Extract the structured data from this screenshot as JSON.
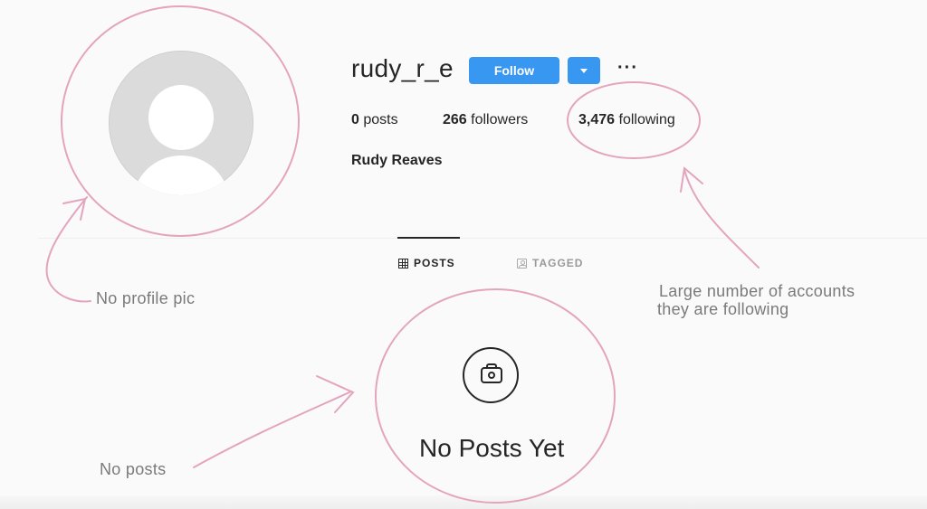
{
  "profile": {
    "username": "rudy_r_e",
    "full_name": "Rudy Reaves",
    "follow_label": "Follow",
    "more_label": "···",
    "stats": {
      "posts": {
        "count": "0",
        "label": "posts"
      },
      "followers": {
        "count": "266",
        "label": "followers"
      },
      "following": {
        "count": "3,476",
        "label": "following"
      }
    }
  },
  "tabs": [
    {
      "label": "POSTS",
      "icon": "grid-icon",
      "active": true
    },
    {
      "label": "TAGGED",
      "icon": "tagged-person-icon",
      "active": false
    }
  ],
  "empty_state": {
    "icon": "camera-icon",
    "title": "No Posts Yet"
  },
  "annotations": {
    "no_profile_pic": "No profile pic",
    "following_line1": "Large number of accounts",
    "following_line2": "they are following",
    "no_posts": "No posts"
  },
  "colors": {
    "accent": "#3897f0",
    "annotation_pink": "#e4a4bd",
    "background": "#fafafa",
    "text": "#262626"
  }
}
